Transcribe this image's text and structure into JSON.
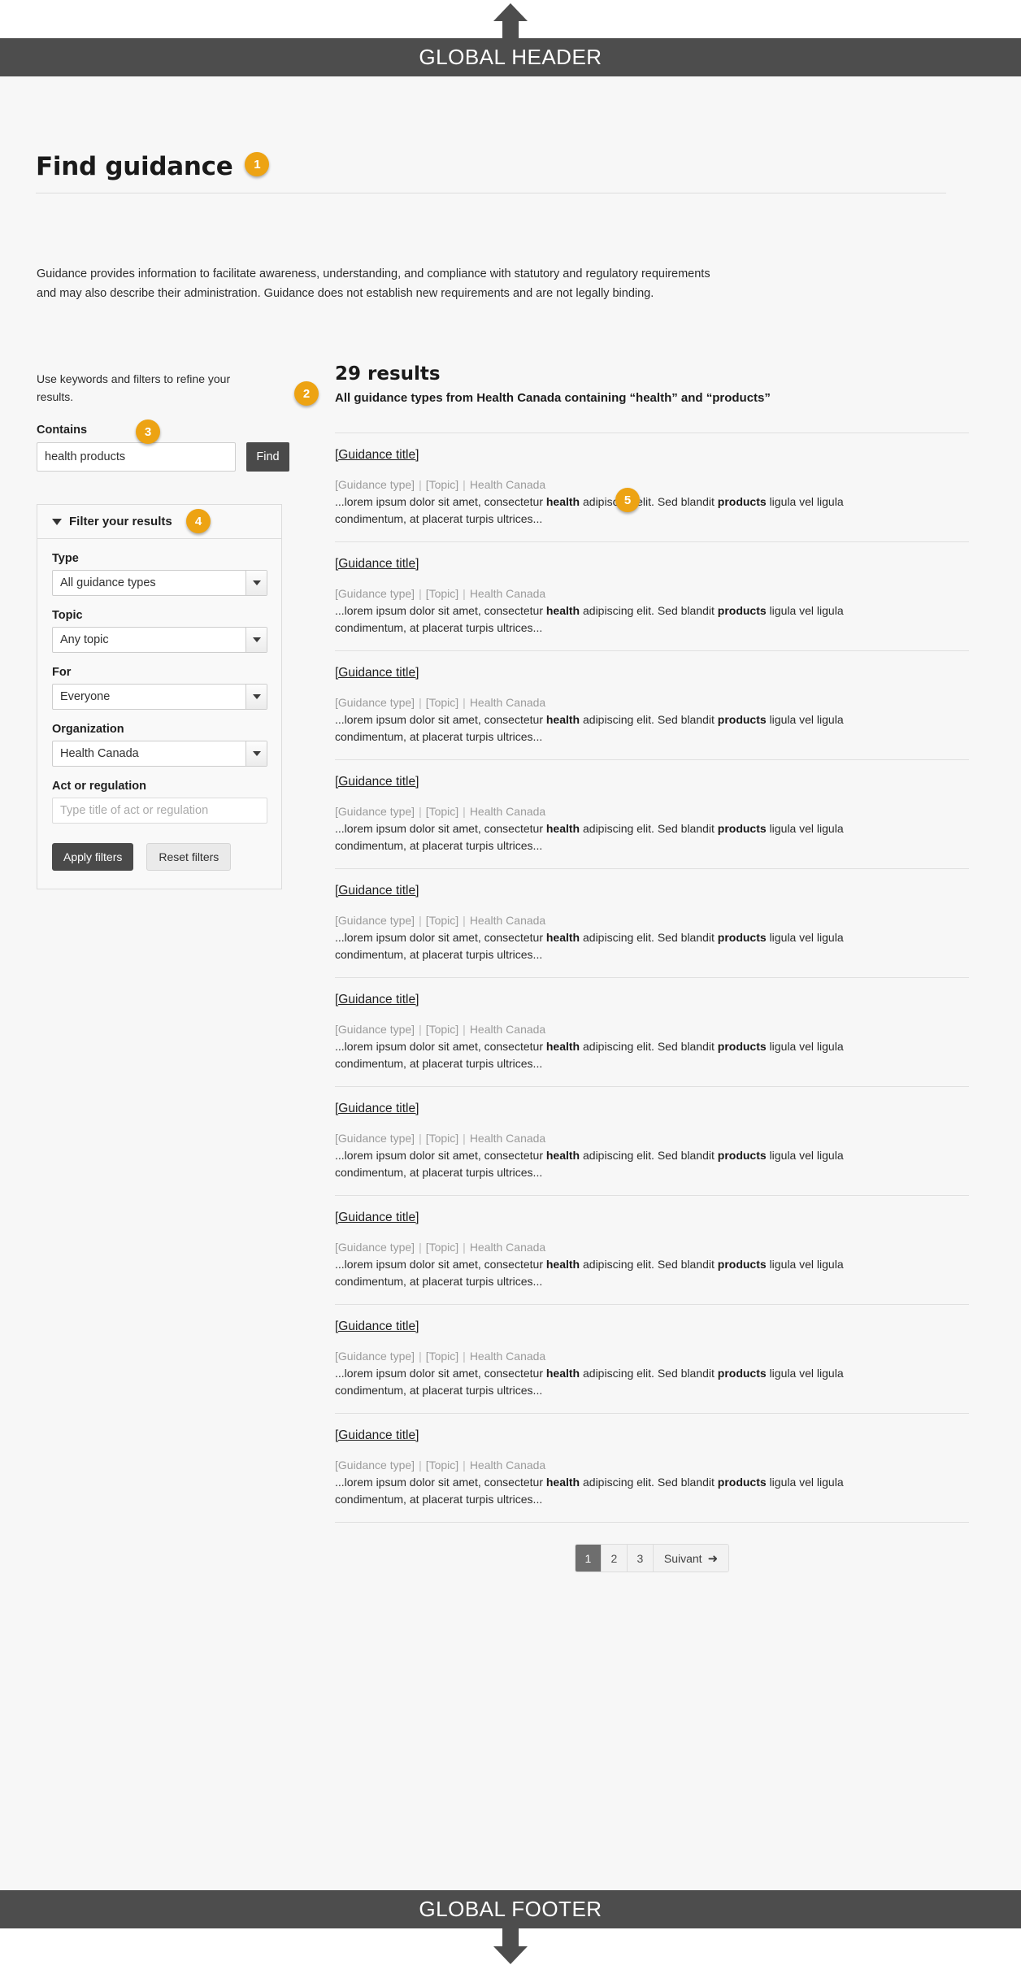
{
  "global": {
    "header_label": "GLOBAL HEADER",
    "footer_label": "GLOBAL FOOTER"
  },
  "page": {
    "title": "Find guidance",
    "marker_1": "1",
    "intro": "Guidance provides information to facilitate awareness, understanding, and compliance with statutory and regulatory requirements and may also describe their administration.  Guidance does not establish new requirements and are not legally binding."
  },
  "left": {
    "refine_text": "Use keywords and filters to refine your results.",
    "contains_label": "Contains",
    "contains_value": "health products",
    "contains_placeholder": "health products",
    "find_label": "Find",
    "marker_3": "3",
    "filter_header": "Filter your results",
    "marker_4": "4",
    "fields": [
      {
        "label": "Type",
        "value": "All guidance types",
        "control": "select"
      },
      {
        "label": "Topic",
        "value": "Any topic",
        "control": "select"
      },
      {
        "label": "For",
        "value": "Everyone",
        "control": "select"
      },
      {
        "label": "Organization",
        "value": "Health Canada",
        "control": "select"
      },
      {
        "label": "Act or regulation",
        "value": "",
        "placeholder": "Type title of act or regulation",
        "control": "text"
      }
    ],
    "apply_label": "Apply filters",
    "reset_label": "Reset filters"
  },
  "results": {
    "marker_2": "2",
    "marker_5": "5",
    "count_label": "29 results",
    "summary": "All guidance types from Health Canada containing “health” and “products”",
    "item_title": "[Guidance title]",
    "meta_type": "[Guidance type]",
    "meta_topic": "[Topic]",
    "meta_org": "Health Canada",
    "meta_sep": "|",
    "snippet_1": "...lorem ipsum dolor sit amet, consectetur ",
    "snippet_bold_1": "health",
    "snippet_2": " adipiscing elit. Sed blandit ",
    "snippet_bold_2": "products",
    "snippet_3": " ligula vel ligula condimentum, at placerat turpis ultrices...",
    "item_count": 10
  },
  "pagination": {
    "pages": [
      "1",
      "2",
      "3"
    ],
    "active": "1",
    "next_label": "Suivant",
    "next_icon": "arrow-right-icon"
  },
  "colors": {
    "accent": "#eda313",
    "bar": "#4d4d4d",
    "sheet": "#f7f7f7"
  }
}
